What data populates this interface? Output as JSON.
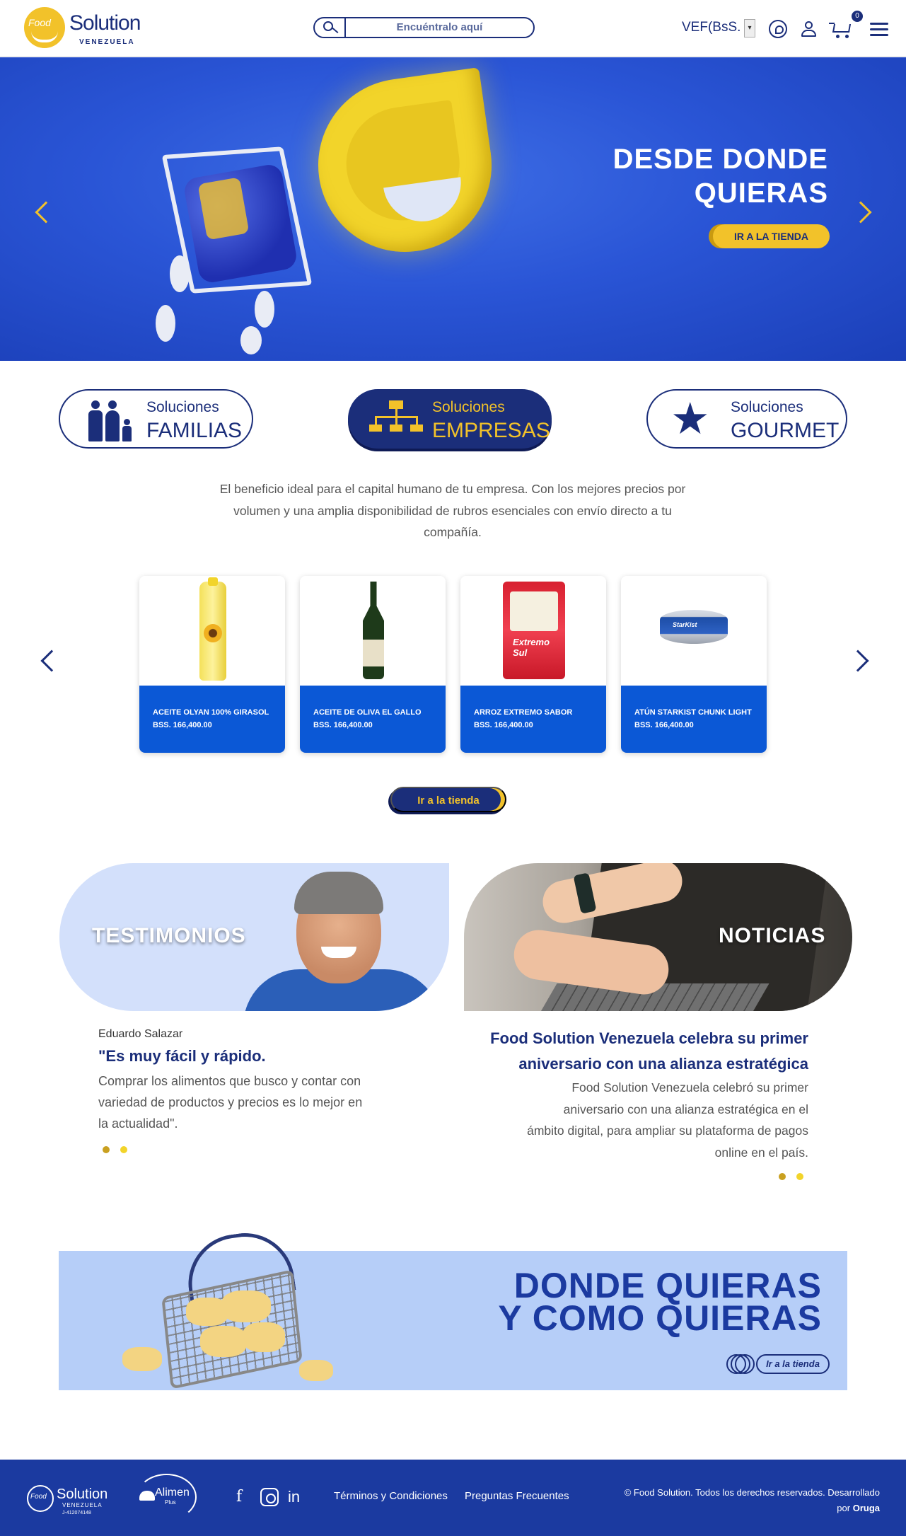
{
  "header": {
    "logo_food": "Food",
    "logo_brand": "Solution",
    "logo_sub": "VENEZUELA",
    "search_placeholder": "Encuéntralo aquí",
    "currency": "VEF(BsS. )",
    "currency_select_arrow": "▾",
    "cart_count": "0",
    "icons": [
      "search-icon",
      "whatsapp-icon",
      "user-icon",
      "cart-icon",
      "menu-icon"
    ]
  },
  "hero": {
    "title_line1": "DESDE DONDE",
    "title_line2": "QUIERAS",
    "button": "IR A LA TIENDA"
  },
  "solutions": [
    {
      "label_top": "Soluciones",
      "label_main": "FAMILIAS",
      "icon": "family-icon",
      "active": false
    },
    {
      "label_top": "Soluciones",
      "label_main": "EMPRESAS",
      "icon": "org-chart-icon",
      "active": true
    },
    {
      "label_top": "Soluciones",
      "label_main": "GOURMET",
      "icon": "star-icon",
      "active": false
    }
  ],
  "intro": "El beneficio ideal para el capital humano de tu empresa. Con los mejores precios por volumen y una amplia disponibilidad de rubros esenciales con envío directo a tu compañía.",
  "products": [
    {
      "name": "ACEITE OLYAN 100% GIRASOL",
      "price": "BSS. 166,400.00"
    },
    {
      "name": "ACEITE DE OLIVA EL GALLO",
      "price": "BSS. 166,400.00"
    },
    {
      "name": "ARROZ EXTREMO SABOR",
      "price": "BSS. 166,400.00"
    },
    {
      "name": "ATÚN STARKIST CHUNK LIGHT",
      "price": "BSS. 166,400.00"
    }
  ],
  "product_art": {
    "rice_label": "Extremo Sul",
    "can_label": "StarKist"
  },
  "store_button": "Ir a la tienda",
  "testimonials": {
    "panel_title": "TESTIMONIOS",
    "author": "Eduardo Salazar",
    "quote": "\"Es muy fácil y rápido.",
    "body": "Comprar los alimentos que busco y contar con variedad de productos y precios es lo mejor en la actualidad\"."
  },
  "news": {
    "panel_title": "NOTICIAS",
    "title": "Food Solution Venezuela celebra su primer aniversario con una alianza estratégica",
    "body": "Food Solution Venezuela celebró su primer aniversario con una alianza estratégica en el ámbito digital, para ampliar su plataforma de pagos online en el país."
  },
  "banner": {
    "line1": "DONDE QUIERAS",
    "line2": "Y COMO QUIERAS",
    "button": "Ir a la tienda"
  },
  "footer": {
    "logo_food": "Food",
    "logo_brand": "Solution",
    "logo_sub": "VENEZUELA",
    "rif": "J-412074148",
    "alimen": "Alimen",
    "alimen_sub": "Plus",
    "social": [
      "facebook-icon",
      "instagram-icon",
      "linkedin-icon"
    ],
    "social_f": "f",
    "social_in": "in",
    "link_terms": "Términos y Condiciones",
    "link_faq": "Preguntas Frecuentes",
    "copyright": "© Food Solution. Todos los derechos reservados. Desarrollado",
    "by_prefix": "por",
    "by_name": "Oruga"
  },
  "colors": {
    "navy": "#1b2e7a",
    "yellow": "#f2c22a",
    "blue": "#0b58d6",
    "footer": "#1b3aa0",
    "banner": "#b6cef8"
  }
}
